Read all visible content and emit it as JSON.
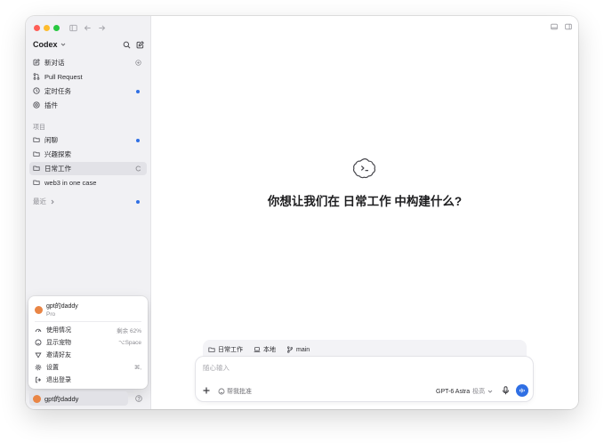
{
  "app": {
    "name": "Codex"
  },
  "sidebar": {
    "nav": [
      {
        "label": "新对话",
        "icon": "edit-icon"
      },
      {
        "label": "Pull Request",
        "icon": "pull-request-icon"
      },
      {
        "label": "定时任务",
        "icon": "clock-icon"
      },
      {
        "label": "插件",
        "icon": "plugin-icon"
      }
    ],
    "projects_label": "项目",
    "projects": [
      {
        "label": "闲聊",
        "icon": "folder-icon"
      },
      {
        "label": "兴趣探索",
        "icon": "folder-icon"
      },
      {
        "label": "日常工作",
        "icon": "folder-icon"
      },
      {
        "label": "web3 in one case",
        "icon": "folder-icon"
      }
    ],
    "recent_label": "最近"
  },
  "account_menu": {
    "user_name": "gpt的daddy",
    "plan": "Pro",
    "items": [
      {
        "label": "使用情况",
        "meta": "剩余 62%",
        "icon": "gauge-icon"
      },
      {
        "label": "显示宠物",
        "meta": "⌥Space",
        "icon": "pet-icon"
      },
      {
        "label": "邀请好友",
        "meta": "",
        "icon": "gift-icon"
      },
      {
        "label": "设置",
        "meta": "⌘,",
        "icon": "gear-icon"
      },
      {
        "label": "退出登录",
        "meta": "",
        "icon": "logout-icon"
      }
    ]
  },
  "account": {
    "name": "gpt的daddy"
  },
  "main": {
    "prompt_title": "你想让我们在 日常工作 中构建什么?",
    "context": {
      "project": "日常工作",
      "environment": "本地",
      "branch": "main"
    },
    "composer": {
      "placeholder": "随心输入",
      "approval": "帮我批准",
      "model": "GPT-6 Astra",
      "effort": "极高"
    }
  },
  "colors": {
    "accent": "#2f6fe4",
    "sidebar_bg": "#f1f1f4",
    "avatar": "#e98545"
  }
}
